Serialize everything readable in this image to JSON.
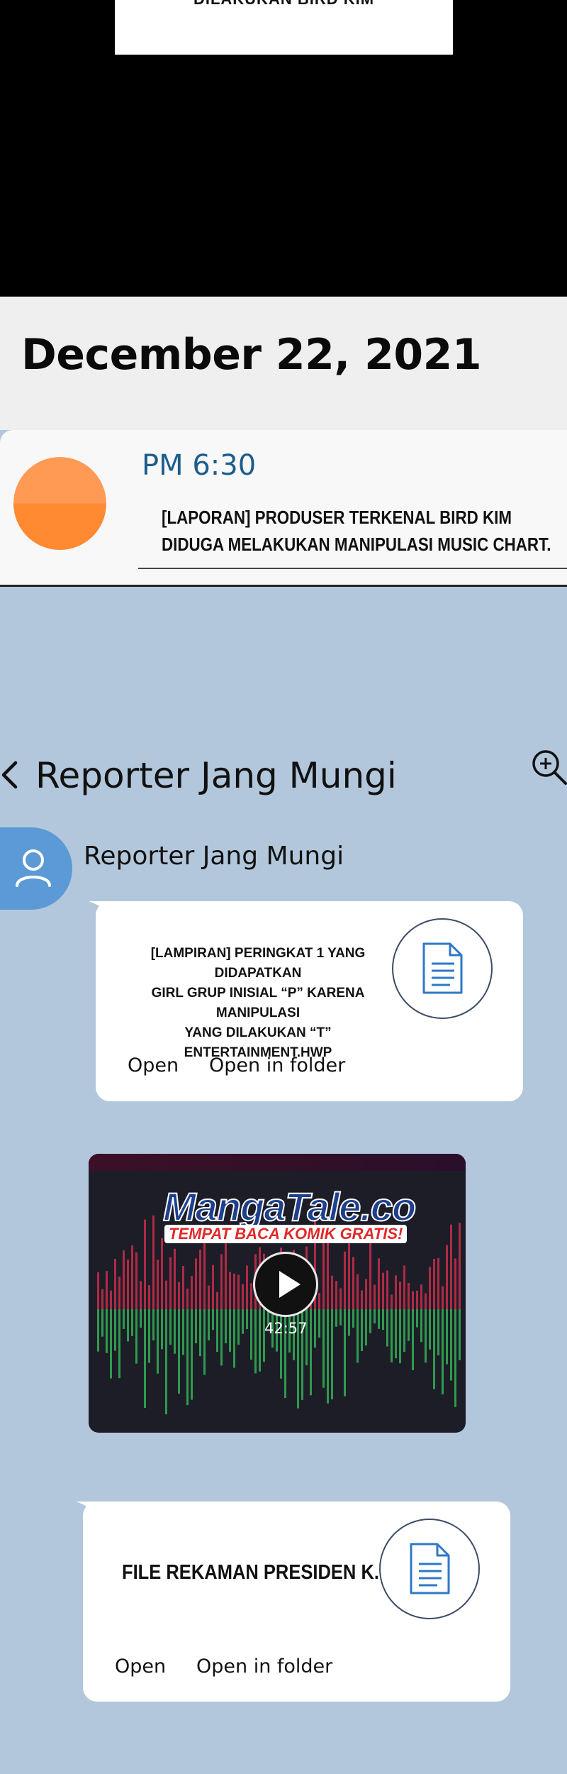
{
  "top_card": {
    "text": "DILAKUKAN BIRD KIM"
  },
  "date": {
    "title": "December 22, 2021"
  },
  "notification": {
    "time": "PM 6:30",
    "line1": "[LAPORAN] PRODUSER TERKENAL BIRD KIM",
    "line2": "DIDUGA MELAKUKAN MANIPULASI MUSIC CHART."
  },
  "chat": {
    "title": "Reporter Jang Mungi",
    "sender": "Reporter Jang Mungi"
  },
  "attachment1": {
    "line1": "[LAMPIRAN] PERINGKAT 1 YANG DIDAPATKAN",
    "line2": "GIRL GRUP INISIAL “P” KARENA MANIPULASI",
    "line3": "YANG DILAKUKAN “T” ENTERTAINMENT.HWP",
    "open": "Open",
    "open_folder": "Open in folder"
  },
  "video": {
    "logo_main": "MangaTale.co",
    "logo_sub": "TEMPAT BACA KOMIK GRATIS!",
    "duration": "42:57"
  },
  "attachment2": {
    "filename": "FILE REKAMAN PRESIDEN K.WAV",
    "open": "Open",
    "open_folder": "Open in folder"
  },
  "colors": {
    "chat_background": "#b3c7dc",
    "time_blue": "#1c5d8c",
    "avatar_blue": "#5b9ad6",
    "notif_orange": "#ff8a32",
    "wave_red": "#b02a45",
    "wave_green": "#2f9a4e"
  },
  "icons": [
    "back-chevron-icon",
    "zoom-in-icon",
    "user-icon",
    "document-icon",
    "play-icon"
  ]
}
